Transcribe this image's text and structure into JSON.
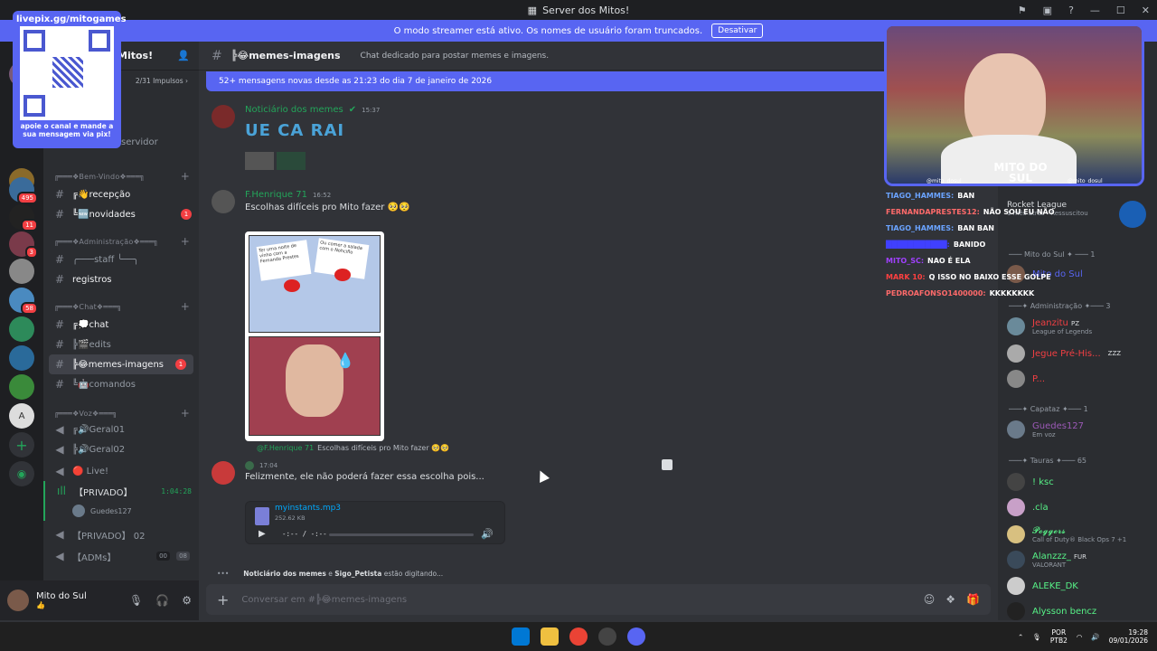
{
  "titlebar": {
    "title": "Server dos Mitos!"
  },
  "streamer_banner": {
    "text": "O modo streamer está ativo. Os nomes de usuário foram truncados.",
    "button": "Desativar"
  },
  "qr_overlay": {
    "top": "livepix.gg/mitogames",
    "bottom": "apoie o canal e mande a sua mensagem via pix!"
  },
  "server": {
    "name": "Mitos!",
    "boosts": "2/31 Impulsos",
    "servidor": "servidor"
  },
  "servers": [
    {
      "badge": ""
    },
    {
      "badge": "495"
    },
    {
      "badge": "11"
    },
    {
      "badge": "3"
    },
    {
      "badge": ""
    },
    {
      "badge": "58"
    },
    {
      "badge": ""
    },
    {
      "badge": ""
    },
    {
      "badge": ""
    },
    {
      "badge": ""
    }
  ],
  "channels": {
    "cat_bemvindo": "╔═══❖Bem-Vindo❖═══╗",
    "recepcao": "╔👋recepção",
    "novidades": "╚🆕novidades",
    "novidades_badge": "1",
    "cat_admin": "╔═══❖Administração❖═══╗",
    "staff": "╭───staff ╰──╮",
    "registros": "registros",
    "cat_chat": "╔═══❖Chat❖═══╗",
    "chat": "╔💭chat",
    "edits": "╠🎬edits",
    "memes": "╠😂memes-imagens",
    "memes_badge": "1",
    "comandos": "╚🤖comandos",
    "cat_voz": "╔═══❖Voz❖═══╗",
    "geral01": "╔🔊Geral01",
    "geral02": "╠🔊Geral02",
    "live": "🔴 Live!",
    "privado": "【PRIVADO】",
    "privado_time": "1:04:28",
    "privado_user": "Guedes127",
    "privado02": "【PRIVADO】 02",
    "adms": "【ADMs】",
    "adms_a": "00",
    "adms_b": "08"
  },
  "user": {
    "name": "Mito do Sul",
    "status": "👍"
  },
  "chat_header": {
    "channel": "╠😂memes-imagens",
    "topic": "Chat dedicado para postar memes e imagens."
  },
  "new_messages": "52+ mensagens novas desde as 21:23 do dia 7 de janeiro de 2026",
  "messages": {
    "m1_author": "Noticiário dos memes",
    "m1_time": "15:37",
    "m1_text": "UE CA RAI",
    "m2_author": "F.Henrique 71",
    "m2_time": "16:52",
    "m2_text": "Escolhas difíceis pro Mito fazer 🥺🥺",
    "meme_top_left": "Ter uma noite de vinho com a Fernanda Prestes",
    "meme_top_right": "Ou comer a salada com o Nohciflo",
    "reply_author": "@F.Henrique 71",
    "reply_text": "Escolhas difíceis pro Mito fazer 🥺🥺",
    "m3_time": "17:04",
    "m3_text": "Felizmente, ele não poderá fazer essa escolha pois...",
    "file_name": "myinstants.mp3",
    "file_size": "252.62 KB",
    "audio_time": "-:-- / -:--"
  },
  "typing": {
    "names": "Noticiário dos memes",
    "and": " e ",
    "name2": "Sigo_Petista",
    "suffix": " estão digitando..."
  },
  "composer": {
    "placeholder": "Conversar em #╠😂memes-imagens"
  },
  "overlay_chat": [
    {
      "user": "TIAGO_HAMMES:",
      "msg": "BAN",
      "color": "#6aa3ff"
    },
    {
      "user": "FERNANDAPRESTES12:",
      "msg": "NÃO SOU EU NÃO",
      "color": "#ff6a6a"
    },
    {
      "user": "TIAGO_HAMMES:",
      "msg": "BAN BAN",
      "color": "#6aa3ff"
    },
    {
      "user": "███████████:",
      "msg": "BANIDO",
      "color": "#4040ff"
    },
    {
      "user": "MITO_SC:",
      "msg": "NAO É ELA",
      "color": "#a040ff"
    },
    {
      "user": "MARK 10:",
      "msg": "Q ISSO NO BAIXO ESSE GOLPE",
      "color": "#ff4040"
    },
    {
      "user": "PEDROAFONSO1400000:",
      "msg": "KKKKKKKK",
      "color": "#ff6a6a"
    }
  ],
  "members": {
    "game_title": "Rocket League",
    "game_sub": "1 mês atrás · Ressuscitou",
    "cat_mito": "─── Mito do Sul ✦ ─── 1",
    "mito": "Mito do Sul",
    "cat_admin": "───✦ Administração ✦─── 3",
    "jeanzitu": "Jeanzitu",
    "jeanzitu_tag": "PZ",
    "jeanzitu_sub": "League of Legends",
    "jegue": "Jegue Pré-His...",
    "jegue_tag": "ZZZ",
    "p": "P...",
    "cat_capataz": "───✦ Capataz ✦─── 1",
    "guedes": "Guedes127",
    "guedes_sub": "Em voz",
    "cat_tauras": "───✦ Tauras ✦─── 65",
    "ksc": "! ksc",
    "cla": ".cla",
    "pogger": "𝓟𝓸𝓰𝓰𝓮𝓻𝓼",
    "pogger_sub": "Call of Duty® Black Ops 7 +1",
    "alanzzz": "Alanzzz_",
    "alanzzz_tag": "FUR",
    "alanzzz_sub": "VALORANT",
    "aleke": "ALEKE_DK",
    "alysson": "Alysson bencz"
  },
  "webcam": {
    "name": "MITO DO SUL",
    "ig": "@mito_dosul",
    "tt": "@mito_dosul"
  },
  "taskbar": {
    "lang": "POR",
    "kbd": "PTB2",
    "time": "19:28",
    "date": "09/01/2026"
  },
  "colors": {
    "blurple": "#5865f2",
    "green": "#23a55a",
    "red": "#f23f43"
  }
}
